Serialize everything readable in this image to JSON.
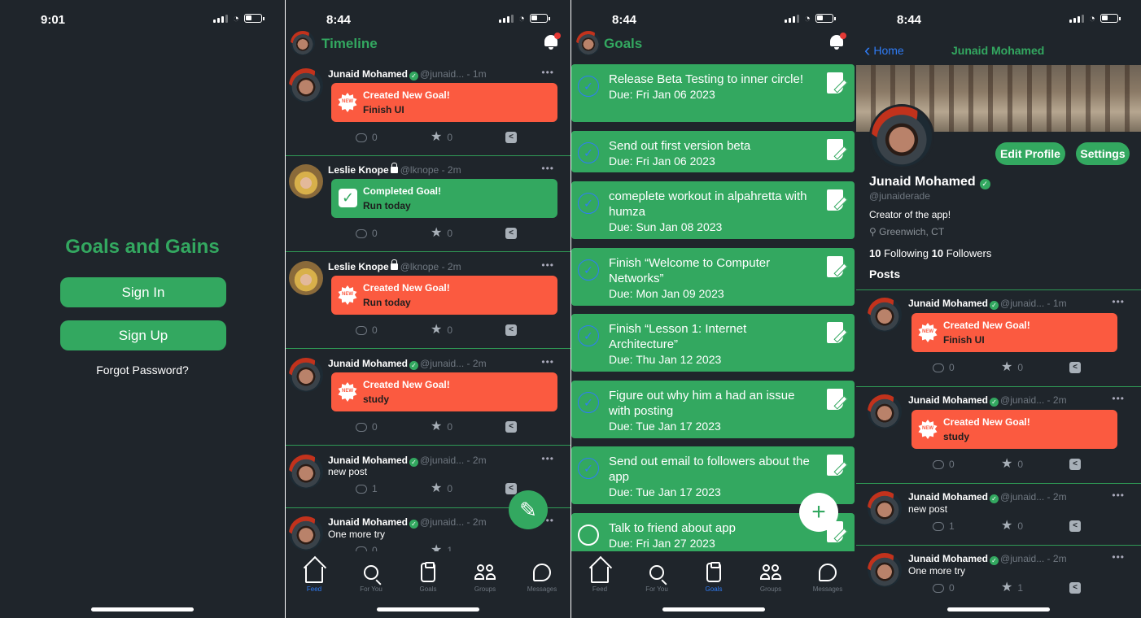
{
  "screen1": {
    "time": "9:01",
    "title": "Goals and Gains",
    "sign_in": "Sign In",
    "sign_up": "Sign Up",
    "forgot": "Forgot Password?"
  },
  "screen2": {
    "time": "8:44",
    "title": "Timeline",
    "posts": [
      {
        "name": "Junaid Mohamed",
        "meta": "@junaid... - 1m",
        "card": "red",
        "l1": "Created New Goal!",
        "l2": "Finish UI",
        "c": "0",
        "s": "0"
      },
      {
        "name": "Leslie Knope",
        "meta": "@lknope - 2m",
        "card": "green",
        "l1": "Completed Goal!",
        "l2": "Run today",
        "c": "0",
        "s": "0"
      },
      {
        "name": "Leslie Knope",
        "meta": "@lknope - 2m",
        "card": "red",
        "l1": "Created New Goal!",
        "l2": "Run today",
        "c": "0",
        "s": "0"
      },
      {
        "name": "Junaid Mohamed",
        "meta": "@junaid... - 2m",
        "card": "red",
        "l1": "Created New Goal!",
        "l2": "study",
        "c": "0",
        "s": "0"
      },
      {
        "name": "Junaid Mohamed",
        "meta": "@junaid... - 2m",
        "text": "new post",
        "c": "1",
        "s": "0"
      },
      {
        "name": "Junaid Mohamed",
        "meta": "@junaid... - 2m",
        "text": "One more try",
        "c": "0",
        "s": "1"
      }
    ]
  },
  "screen3": {
    "time": "8:44",
    "title": "Goals",
    "goals": [
      {
        "title": "Release Beta Testing to inner circle!",
        "due": "Due: Fri Jan 06 2023",
        "done": true
      },
      {
        "title": "Send out first version beta",
        "due": "Due: Fri Jan 06 2023",
        "done": true
      },
      {
        "title": "comeplete workout in alpahretta with humza",
        "due": "Due: Sun Jan 08 2023",
        "done": true
      },
      {
        "title": "Finish “Welcome to Computer Networks”",
        "due": "Due: Mon Jan 09 2023",
        "done": true
      },
      {
        "title": "Finish “Lesson 1: Internet Architecture”",
        "due": "Due: Thu Jan 12 2023",
        "done": true
      },
      {
        "title": "Figure out why him a had an issue with posting",
        "due": "Due: Tue Jan 17 2023",
        "done": true
      },
      {
        "title": "Send out email to followers about the app",
        "due": "Due: Tue Jan 17 2023",
        "done": true
      },
      {
        "title": "Talk to friend about app",
        "due": "Due: Fri Jan 27 2023",
        "done": false
      }
    ]
  },
  "tabs": [
    "Feed",
    "For You",
    "Goals",
    "Groups",
    "Messages"
  ],
  "screen4": {
    "time": "8:44",
    "back": "Home",
    "nav_title": "Junaid Mohamed",
    "edit_profile": "Edit Profile",
    "settings": "Settings",
    "name": "Junaid Mohamed",
    "handle": "@junaiderade",
    "bio": "Creator of the app!",
    "location": "Greenwich, CT",
    "following": "10",
    "following_label": "Following",
    "followers": "10",
    "followers_label": "Followers",
    "posts_label": "Posts",
    "posts": [
      {
        "name": "Junaid Mohamed",
        "meta": "@junaid... - 1m",
        "card": "red",
        "l1": "Created New Goal!",
        "l2": "Finish UI",
        "c": "0",
        "s": "0"
      },
      {
        "name": "Junaid Mohamed",
        "meta": "@junaid... - 2m",
        "card": "red",
        "l1": "Created New Goal!",
        "l2": "study",
        "c": "0",
        "s": "0"
      },
      {
        "name": "Junaid Mohamed",
        "meta": "@junaid... - 2m",
        "text": "new post",
        "c": "1",
        "s": "0"
      },
      {
        "name": "Junaid Mohamed",
        "meta": "@junaid... - 2m",
        "text": "One more try",
        "c": "0",
        "s": "1"
      }
    ]
  },
  "colors": {
    "accent_green": "#33a860",
    "alert_red": "#fb5a40",
    "active_blue": "#2f7cf6",
    "background": "#1f252b"
  }
}
